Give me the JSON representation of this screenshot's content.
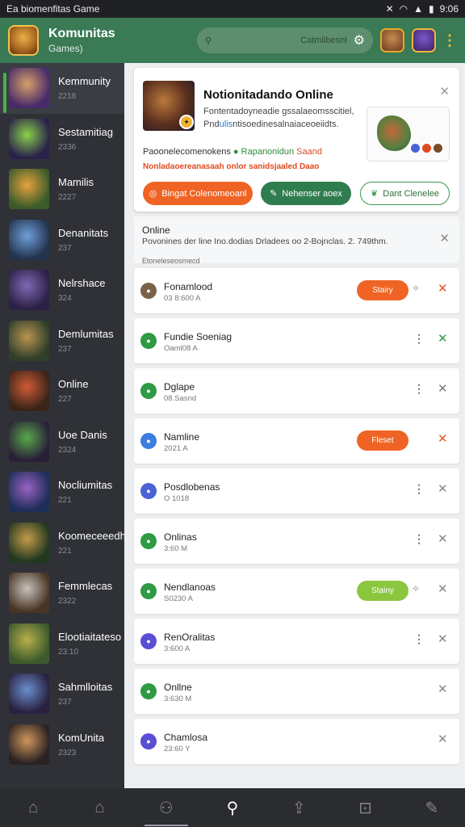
{
  "status_bar": {
    "title": "Ea biomenfitas Game",
    "time": "9:06"
  },
  "header": {
    "title": "Komunitas",
    "subtitle": "Games)",
    "search_placeholder": "Catmlibesnl"
  },
  "sidebar": {
    "items": [
      {
        "name": "Kemmunity",
        "count": "2218",
        "thumb": [
          "#d7a06a",
          "#4a2b6a"
        ]
      },
      {
        "name": "Sestamitiag",
        "count": "2336",
        "thumb": [
          "#8bd04a",
          "#29214a"
        ]
      },
      {
        "name": "Mamilis",
        "count": "2227",
        "thumb": [
          "#e5a23d",
          "#3b5b2a"
        ]
      },
      {
        "name": "Denanitats",
        "count": "237",
        "thumb": [
          "#6fa0d8",
          "#23344f"
        ]
      },
      {
        "name": "Nelrshace",
        "count": "324",
        "thumb": [
          "#8068b3",
          "#2b2147"
        ]
      },
      {
        "name": "Demlumitas",
        "count": "237",
        "thumb": [
          "#b99350",
          "#2f3f2a"
        ]
      },
      {
        "name": "Online",
        "count": "227",
        "thumb": [
          "#d05b36",
          "#3a2418"
        ]
      },
      {
        "name": "Uoe Danis",
        "count": "2324",
        "thumb": [
          "#59a84b",
          "#291f38"
        ]
      },
      {
        "name": "Nocliumitas",
        "count": "221",
        "thumb": [
          "#9a62c4",
          "#1d2e58"
        ]
      },
      {
        "name": "Koomeceeedh",
        "count": "221",
        "thumb": [
          "#c59b4a",
          "#22381f"
        ]
      },
      {
        "name": "Femmlecas",
        "count": "2322",
        "thumb": [
          "#c7c2bc",
          "#4a3525"
        ]
      },
      {
        "name": "Elootiaitateso",
        "count": "23:10",
        "thumb": [
          "#b8b04c",
          "#3d5a2c"
        ]
      },
      {
        "name": "Sahmlloitas",
        "count": "237",
        "thumb": [
          "#6a8fcf",
          "#2a2140"
        ]
      },
      {
        "name": "KomUnita",
        "count": "2323",
        "thumb": [
          "#d0965c",
          "#2b2222"
        ]
      }
    ]
  },
  "featured": {
    "title": "Notionitadando Online",
    "desc_line1": "Fontentadoyneadie gssalaeomsscitiel,",
    "desc_line2_a": "Pnd",
    "desc_line2_b": "ulis",
    "desc_line2_c": "ntisoedinesalnaiaceoeiidts.",
    "line1_a": "Paoonelecomenokens",
    "line1_b": "Rapanonidun",
    "line1_c": "Saand",
    "line2": "Nonladaoereanasaah onlor sanidsjaaled Daao",
    "btn_primary": "Bingat Colenomeoanl",
    "btn_secondary": "Nehenser aoex",
    "btn_outline": "Dant Clenelee"
  },
  "online_panel": {
    "heading": "Online",
    "subtitle": "Povonines der line Ino.dodias Drladees oo 2-Bojnclas. 2. 749thm.",
    "caption": "Etoneleseosmecd"
  },
  "list": [
    {
      "name": "Fonamlood",
      "status": "03 8:600 A",
      "icon_color": "#7a6249",
      "pill": "Stairy",
      "pill_color": "#ef6424",
      "tail": "spark",
      "x_color": "#e0581f"
    },
    {
      "name": "Fundie Soeniag",
      "status": "Oaml08 A",
      "icon_color": "#2e9a43",
      "pill": "",
      "pill_color": "",
      "tail": "dots",
      "x_color": "#2e9a43"
    },
    {
      "name": "Dglape",
      "status": "08.Sasnd",
      "icon_color": "#2e9a43",
      "pill": "",
      "pill_color": "",
      "tail": "dots",
      "x_color": "#777"
    },
    {
      "name": "Namline",
      "status": "2021 A",
      "icon_color": "#3d7de0",
      "pill": "Fleset",
      "pill_color": "#ef6424",
      "tail": "none",
      "x_color": "#e0581f"
    },
    {
      "name": "Posdlobenas",
      "status": "O 1018",
      "icon_color": "#4a63d6",
      "pill": "",
      "pill_color": "",
      "tail": "dots",
      "x_color": "#888"
    },
    {
      "name": "Onlinas",
      "status": "3:60 M",
      "icon_color": "#2e9a43",
      "pill": "",
      "pill_color": "",
      "tail": "dots",
      "x_color": "#888"
    },
    {
      "name": "Nendlanoas",
      "status": "S0230 A",
      "icon_color": "#2e9a43",
      "pill": "Stainy",
      "pill_color": "#8cc63f",
      "tail": "spark",
      "x_color": "#888"
    },
    {
      "name": "RenOralitas",
      "status": "3:600 A",
      "icon_color": "#5a4ed6",
      "pill": "",
      "pill_color": "",
      "tail": "dots",
      "x_color": "#888"
    },
    {
      "name": "Onllne",
      "status": "3:630 M",
      "icon_color": "#2e9a43",
      "pill": "",
      "pill_color": "",
      "tail": "none",
      "x_color": "#888"
    },
    {
      "name": "Chamlosa",
      "status": "23:60 Y",
      "icon_color": "#5a4ed6",
      "pill": "",
      "pill_color": "",
      "tail": "none",
      "x_color": "#888"
    }
  ],
  "bottom_nav": [
    {
      "name": "home-icon",
      "glyph": "⌂",
      "active": false
    },
    {
      "name": "house-icon",
      "glyph": "⌂",
      "active": false
    },
    {
      "name": "community-icon",
      "glyph": "⚇",
      "active": false
    },
    {
      "name": "search-icon",
      "glyph": "⚲",
      "active": true
    },
    {
      "name": "upload-icon",
      "glyph": "⇪",
      "active": false
    },
    {
      "name": "inbox-icon",
      "glyph": "⊡",
      "active": false
    },
    {
      "name": "edit-icon",
      "glyph": "✎",
      "active": false
    }
  ]
}
